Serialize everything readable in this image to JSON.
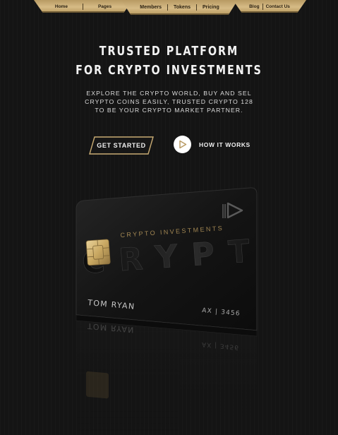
{
  "nav": {
    "group1": [
      "Home",
      "Pages"
    ],
    "group2": [
      "Members",
      "Tokens",
      "Pricing"
    ],
    "group3": [
      "Blog",
      "Contact Us"
    ]
  },
  "hero": {
    "headline_line1": "TRUSTED PLATFORM",
    "headline_line2": "FOR CRYPTO INVESTMENTS",
    "subtext": "EXPLORE THE CRYPTO WORLD, BUY AND SEL CRYPTO COINS EASILY, TRUSTED CRYPTO  128 TO BE YOUR CRYPTO MARKET PARTNER.",
    "cta_label": "GET STARTED",
    "how_label": "HOW IT WORKS"
  },
  "card": {
    "tagline": "CRYPTO INVESTMENTS",
    "brand": "CRYPT",
    "holder": "TOM RYAN",
    "number": "AX | 3456"
  },
  "colors": {
    "gold": "#c9ab73",
    "background": "#141414"
  }
}
